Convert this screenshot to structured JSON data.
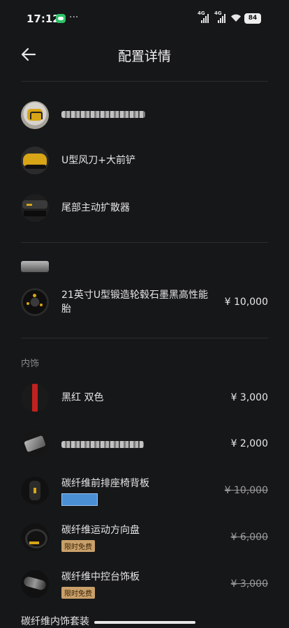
{
  "status_bar": {
    "time": "17:12",
    "signal_label": "4G",
    "battery": "84"
  },
  "header": {
    "title": "配置详情"
  },
  "items": {
    "wind_blade": {
      "label": "U型风刀+大前铲"
    },
    "diffuser": {
      "label": "尾部主动扩散器"
    },
    "wheel": {
      "label": "21英寸U型锻造轮毂石墨黑高性能胎",
      "price": "¥ 10,000"
    },
    "dual_color": {
      "label": "黑红 双色",
      "price": "¥ 3,000"
    },
    "blurred_item": {
      "price": "¥ 2,000"
    },
    "seat_back": {
      "label": "碳纤维前排座椅背板",
      "price": "¥ 10,000"
    },
    "steering": {
      "label": "碳纤维运动方向盘",
      "badge": "限时免费",
      "price": "¥ 6,000"
    },
    "console": {
      "label": "碳纤维中控台饰板",
      "badge": "限时免费",
      "price": "¥ 3,000"
    },
    "interior_kit": {
      "label": "碳纤维内饰套装"
    }
  },
  "sections": {
    "interior": "内饰"
  },
  "colors": {
    "background": "#161719",
    "badge": "#c9a06a",
    "blue_chip": "#4a8fd4",
    "red_stripe": "#c0221f"
  }
}
